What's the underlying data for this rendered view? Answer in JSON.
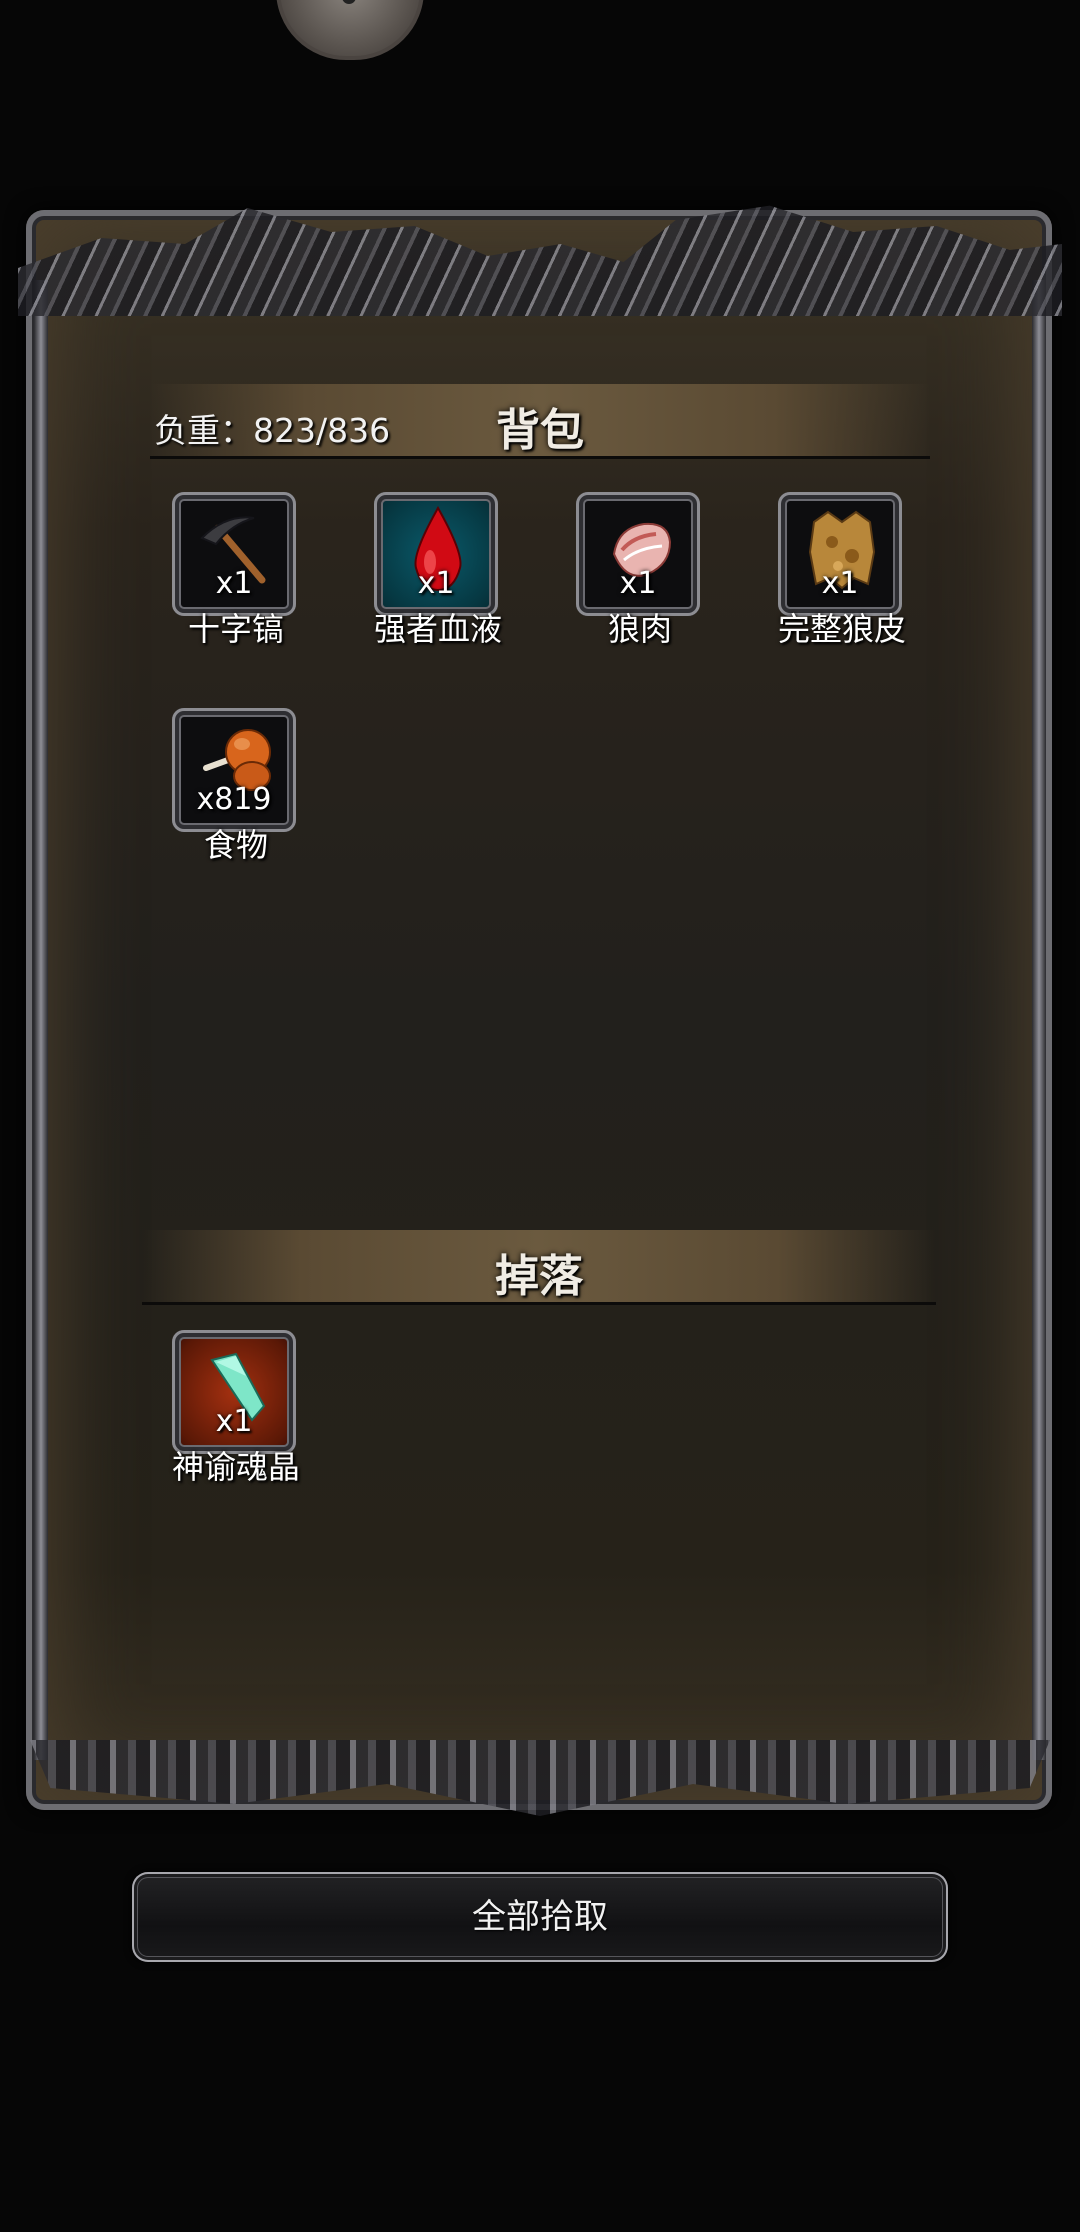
{
  "panel": {
    "weight_label": "负重：823/836",
    "bag_title": "背包",
    "drop_title": "掉落"
  },
  "bag_items": [
    {
      "name": "十字镐",
      "qty": "x1",
      "icon": "pickaxe-icon"
    },
    {
      "name": "强者血液",
      "qty": "x1",
      "icon": "blood-drop-icon"
    },
    {
      "name": "狼肉",
      "qty": "x1",
      "icon": "meat-icon"
    },
    {
      "name": "完整狼皮",
      "qty": "x1",
      "icon": "wolf-pelt-icon"
    },
    {
      "name": "食物",
      "qty": "x819",
      "icon": "drumstick-icon"
    }
  ],
  "drop_items": [
    {
      "name": "神谕魂晶",
      "qty": "x1",
      "icon": "soul-crystal-icon"
    }
  ],
  "actions": {
    "pickup_all_label": "全部拾取"
  },
  "colors": {
    "background": "#060606",
    "panel": "#22201c",
    "header_band": "#6b5a3f",
    "rare_slot_blue": "#0a5a6a",
    "rare_slot_red": "#a43010"
  }
}
